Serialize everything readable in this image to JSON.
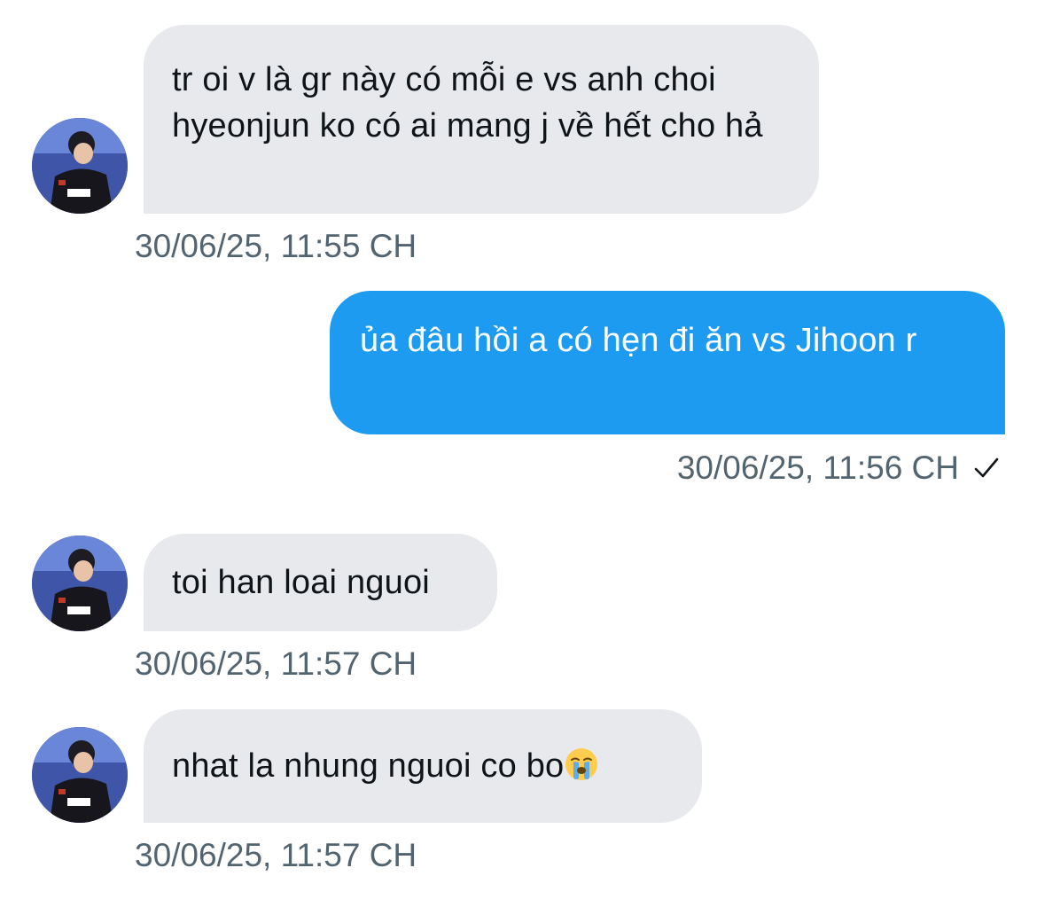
{
  "messages": [
    {
      "direction": "incoming",
      "text": "tr oi v là gr này có mỗi e vs anh choi hyeonjun ko có ai mang j về hết cho hả",
      "timestamp": "30/06/25, 11:55 CH"
    },
    {
      "direction": "outgoing",
      "text": "ủa đâu hồi a có hẹn đi ăn vs Jihoon r",
      "timestamp": "30/06/25, 11:56 CH",
      "status_icon": "checkmark-icon"
    },
    {
      "direction": "incoming",
      "text": "toi han loai nguoi",
      "timestamp": "30/06/25, 11:57 CH"
    },
    {
      "direction": "incoming",
      "text": "nhat la nhung nguoi co bo",
      "emoji": "😭",
      "timestamp": "30/06/25, 11:57 CH"
    }
  ],
  "colors": {
    "incoming_bubble": "#e7e9ec",
    "outgoing_bubble": "#1d9bf0",
    "timestamp": "#536471",
    "incoming_text": "#0f1419"
  }
}
